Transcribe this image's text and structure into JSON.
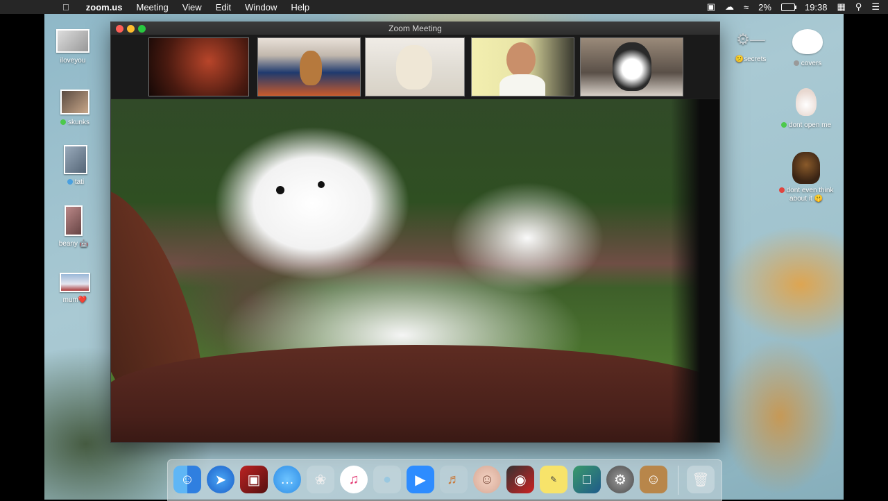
{
  "menubar": {
    "apple": "",
    "app_name": "zoom.us",
    "menus": [
      "Meeting",
      "View",
      "Edit",
      "Window",
      "Help"
    ],
    "battery": "2%",
    "time": "19:38"
  },
  "zoom_window": {
    "title": "Zoom Meeting"
  },
  "desktop_icons_left": [
    {
      "label": "iloveyou",
      "tag": ""
    },
    {
      "label": "skunks",
      "tag": "green"
    },
    {
      "label": "tati",
      "tag": "blue"
    },
    {
      "label": "beany 🤖",
      "tag": ""
    },
    {
      "label": "mum❤️",
      "tag": ""
    }
  ],
  "desktop_icons_right": [
    {
      "label": "secrets",
      "emoji": "😕"
    },
    {
      "label": "covers",
      "tag": "gray"
    },
    {
      "label": "dont open me",
      "tag": "green"
    },
    {
      "label": "dont even think about it 🤫",
      "tag": "red"
    }
  ],
  "dock": {
    "items": [
      "finder-icon",
      "safari-icon",
      "photo-booth-icon",
      "messages-icon",
      "kangaroo-app-icon",
      "itunes-icon",
      "seal-app-icon",
      "zoom-icon",
      "guitar-icon",
      "face-app-icon",
      "photo-app-icon",
      "stickies-icon",
      "preview-icon",
      "system-preferences-icon",
      "contacts-icon",
      "trash-icon"
    ]
  },
  "colors": {
    "close": "#fe5f57",
    "minimize": "#febc2e",
    "maximize": "#28c840",
    "zoom_blue": "#2d8cff"
  }
}
